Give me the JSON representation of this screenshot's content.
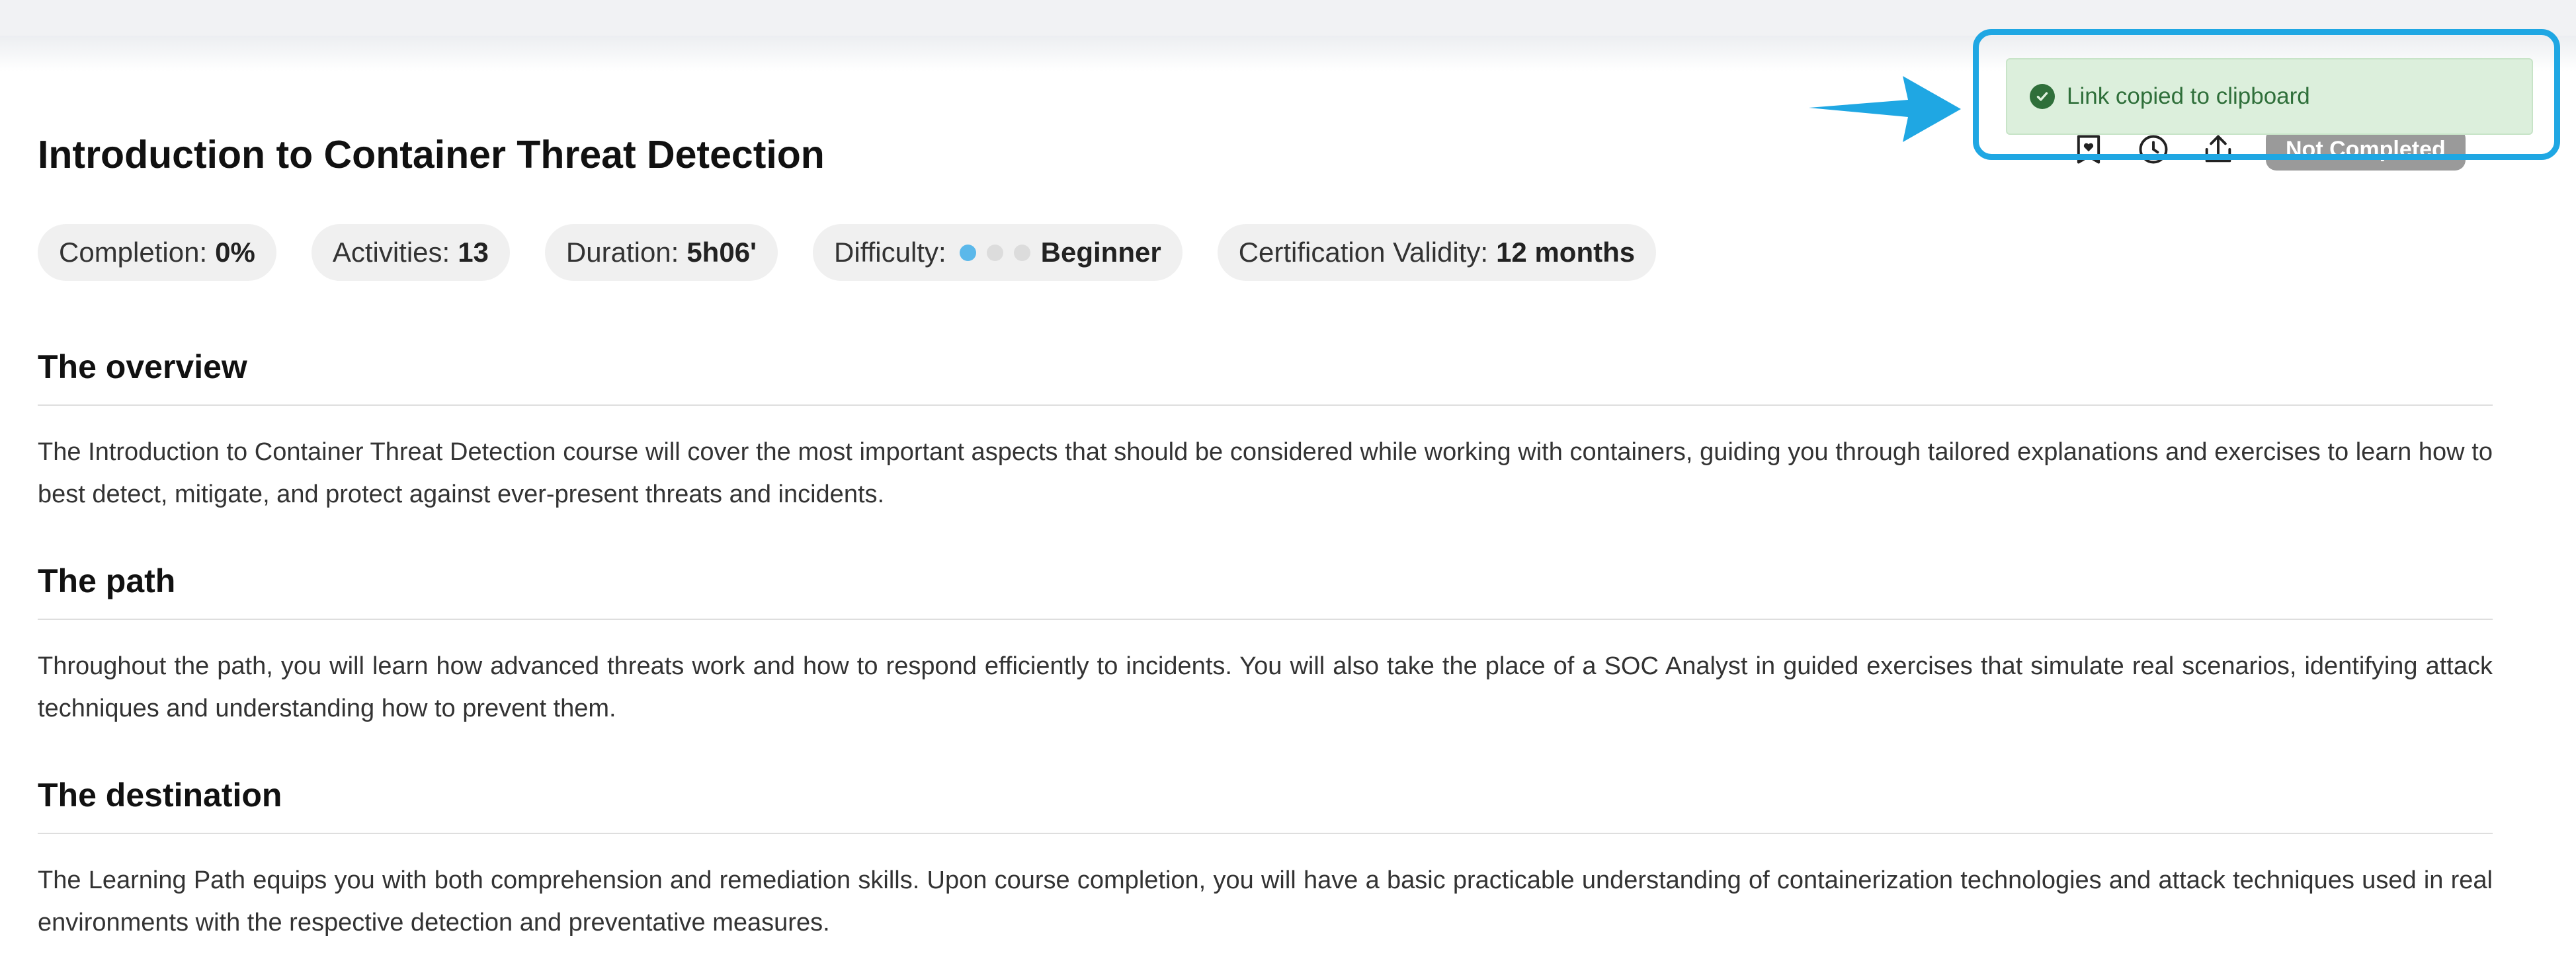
{
  "page": {
    "title": "Introduction to Container Threat Detection"
  },
  "stats": {
    "completion_label": "Completion:",
    "completion_value": "0%",
    "activities_label": "Activities:",
    "activities_value": "13",
    "duration_label": "Duration:",
    "duration_value": "5h06'",
    "difficulty_label": "Difficulty:",
    "difficulty_value": "Beginner",
    "difficulty_level": 1,
    "difficulty_max": 3,
    "certification_label": "Certification Validity:",
    "certification_value": "12 months"
  },
  "sections": [
    {
      "heading": "The overview",
      "body": "The Introduction to Container Threat Detection course will cover the most important aspects that should be considered while working with containers, guiding you through tailored explanations and exercises to learn how to best detect, mitigate, and protect against ever-present threats and incidents."
    },
    {
      "heading": "The path",
      "body": "Throughout the path, you will learn how advanced threats work and how to respond efficiently to incidents. You will also take the place of a SOC Analyst in guided exercises that simulate real scenarios, identifying attack techniques and understanding how to prevent them."
    },
    {
      "heading": "The destination",
      "body": "The Learning Path equips you with both comprehension and remediation skills. Upon course completion, you will have a basic practicable understanding of containerization technologies and attack techniques used in real environments with the respective detection and preventative measures."
    }
  ],
  "actions": {
    "icons": [
      "bookmark-heart-icon",
      "clock-icon",
      "share-icon"
    ],
    "status": "Not Completed"
  },
  "toast": {
    "message": "Link copied to clipboard",
    "icon": "check-circle-icon"
  },
  "colors": {
    "accent": "#1fa7e3",
    "difficulty_on": "#5bb8ea",
    "difficulty_off": "#dcdcdc",
    "toast_bg": "#dcefdc",
    "toast_text": "#2f6f3a",
    "status_badge": "#9a9a9a"
  }
}
